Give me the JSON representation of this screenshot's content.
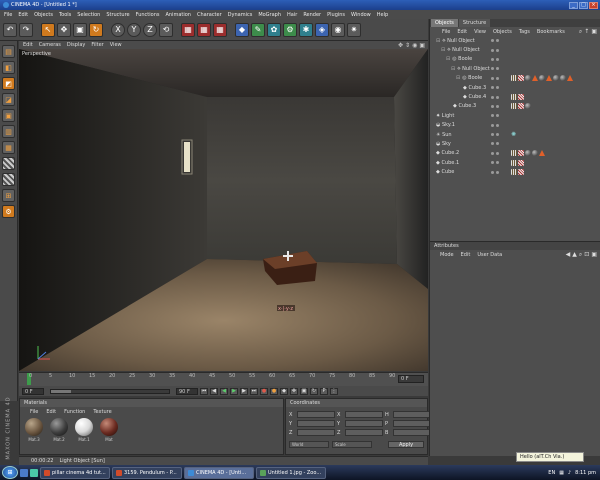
{
  "window": {
    "title": "CINEMA 4D - [Untitled 1 *]"
  },
  "menubar": {
    "items": [
      "File",
      "Edit",
      "Objects",
      "Tools",
      "Selection",
      "Structure",
      "Functions",
      "Animation",
      "Character",
      "Dynamics",
      "MoGraph",
      "Hair",
      "Render",
      "Plugins",
      "Window",
      "Help"
    ]
  },
  "viewport": {
    "menu": [
      "Edit",
      "Cameras",
      "Display",
      "Filter",
      "View"
    ],
    "label": "Perspective"
  },
  "timeline": {
    "ticks": [
      "0",
      "5",
      "10",
      "15",
      "20",
      "25",
      "30",
      "35",
      "40",
      "45",
      "50",
      "55",
      "60",
      "65",
      "70",
      "75",
      "80",
      "85",
      "90"
    ],
    "end_frame": "0 F"
  },
  "transport": {
    "start_field": "0 F",
    "current_field": "90 F"
  },
  "materials": {
    "title": "Materials",
    "menu": [
      "File",
      "Edit",
      "Function",
      "Texture"
    ],
    "items": [
      {
        "name": "Mat.3",
        "color": "#6b5640"
      },
      {
        "name": "Mat.2",
        "color": "#3d3d3d"
      },
      {
        "name": "Mat.1",
        "color": "#d9d9d9"
      },
      {
        "name": "Mat",
        "color": "#6a2a20"
      }
    ]
  },
  "coordinates": {
    "title": "Coordinates",
    "col1": [
      "X",
      "Y",
      "Z"
    ],
    "col2": [
      "X",
      "Y",
      "Z"
    ],
    "col3": [
      "H",
      "P",
      "B"
    ],
    "mode": "World",
    "scale": "Scale",
    "apply_label": "Apply"
  },
  "status": {
    "time": "00:00:22",
    "text": "Light Object [Sun]"
  },
  "objects_panel": {
    "tabs": [
      "Objects",
      "Structure"
    ],
    "menu": [
      "File",
      "Edit",
      "View",
      "Objects",
      "Tags",
      "Bookmarks"
    ],
    "tree": [
      {
        "name": "Null Object",
        "indent": 0
      },
      {
        "name": "Null Object",
        "indent": 1
      },
      {
        "name": "Boole",
        "indent": 2
      },
      {
        "name": "Null Object",
        "indent": 3
      },
      {
        "name": "Boole",
        "indent": 4
      },
      {
        "name": "Cube.3",
        "indent": 5
      },
      {
        "name": "Cube.4",
        "indent": 5
      },
      {
        "name": "Cube.3",
        "indent": 3
      },
      {
        "name": "Light",
        "indent": 0
      },
      {
        "name": "Sky.1",
        "indent": 0
      },
      {
        "name": "Sun",
        "indent": 0
      },
      {
        "name": "Sky",
        "indent": 0
      },
      {
        "name": "Cube.2",
        "indent": 0
      },
      {
        "name": "Cube.1",
        "indent": 0
      },
      {
        "name": "Cube",
        "indent": 0
      }
    ]
  },
  "attributes_panel": {
    "title": "Attributes",
    "menu": [
      "Mode",
      "Edit",
      "User Data"
    ]
  },
  "taskbar": {
    "tasks": [
      {
        "label": "pillar cinema 4d tut...",
        "color": "#d24b2a"
      },
      {
        "label": "3159. Pendulum - P...",
        "color": "#d24b2a"
      },
      {
        "label": "CINEMA 4D - [Unti...",
        "color": "#3d8bd6"
      },
      {
        "label": "Untitled 1.jpg - Zoo...",
        "color": "#5aa25a"
      }
    ],
    "notification": "Hello (alT.Ch Via.)",
    "lang": "EN",
    "clock": "8:11 pm"
  }
}
